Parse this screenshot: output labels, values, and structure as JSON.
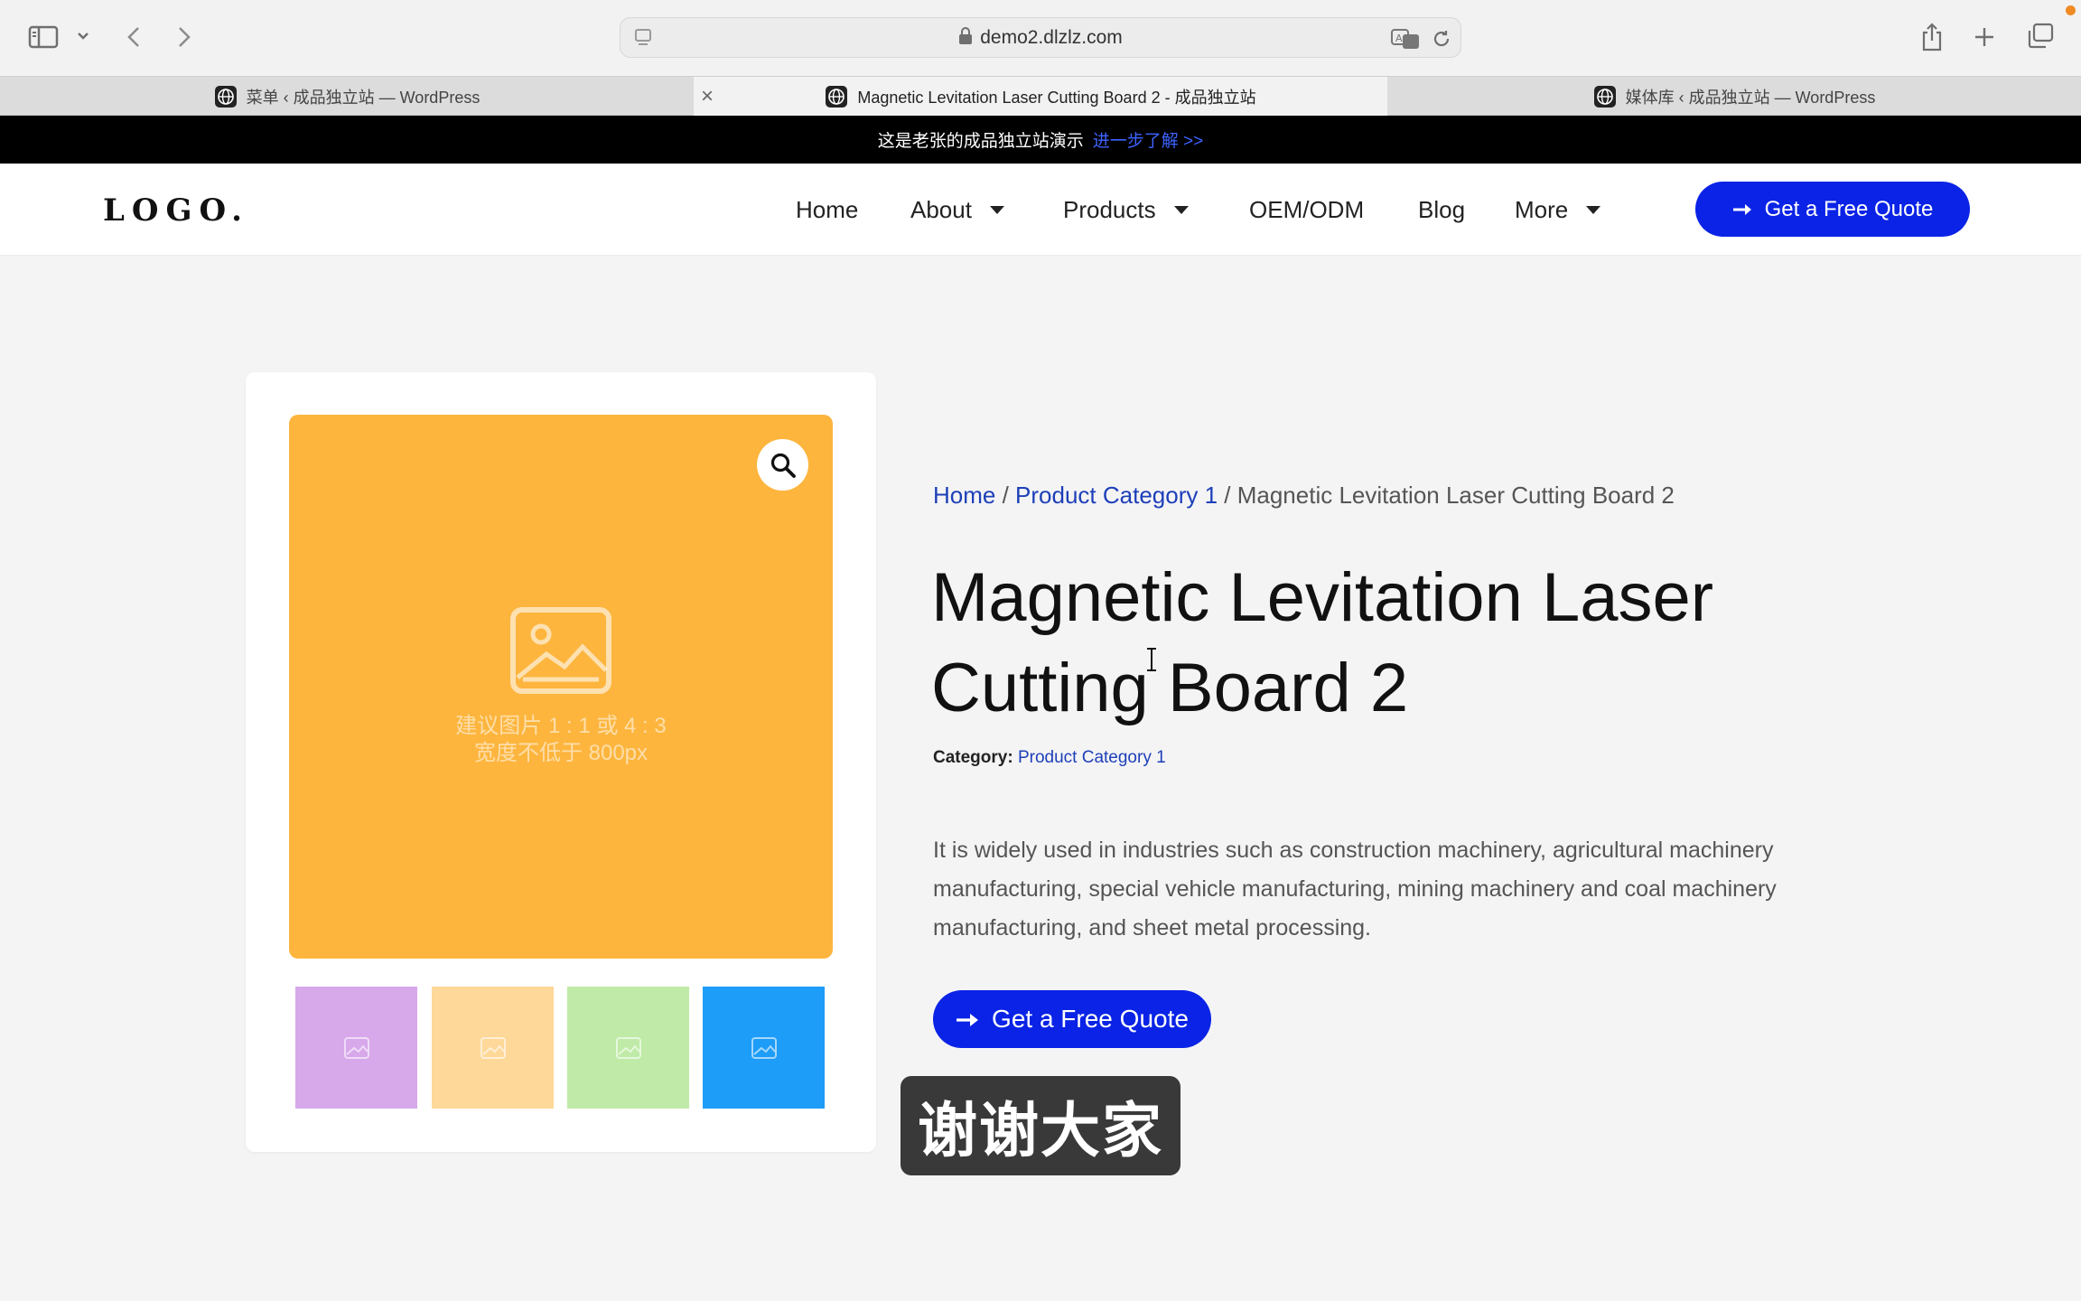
{
  "browser": {
    "url": "demo2.dlzlz.com",
    "tabs": [
      {
        "title": "菜单 ‹ 成品独立站 — WordPress",
        "active": false
      },
      {
        "title": "Magnetic Levitation Laser Cutting Board 2 - 成品独立站",
        "active": true
      },
      {
        "title": "媒体库 ‹ 成品独立站 — WordPress",
        "active": false
      }
    ],
    "tab_close": "×"
  },
  "announcement": {
    "text": "这是老张的成品独立站演示",
    "link": "进一步了解 >>"
  },
  "header": {
    "logo": "LOGO.",
    "nav": [
      {
        "label": "Home"
      },
      {
        "label": "About"
      },
      {
        "label": "Products"
      },
      {
        "label": "OEM/ODM"
      },
      {
        "label": "Blog"
      },
      {
        "label": "More"
      }
    ],
    "cta": "Get a Free Quote"
  },
  "product": {
    "image_caption_line1": "建议图片 1 : 1 或 4 : 3",
    "image_caption_line2": "宽度不低于 800px",
    "thumbnail_colors": [
      "#d7a8ea",
      "#fdd898",
      "#bfeaa7",
      "#1d9cf8"
    ],
    "breadcrumb": {
      "home": "Home",
      "sep": " / ",
      "category": "Product Category 1",
      "current": "Magnetic Levitation Laser Cutting Board 2"
    },
    "title": "Magnetic Levitation Laser Cutting Board 2",
    "category_label": "Category:",
    "category_value": "Product Category 1",
    "description": "It is widely used in industries such as construction machinery, agricultural machinery manufacturing, special vehicle manufacturing, mining machinery and coal machinery manufacturing, and sheet metal processing.",
    "cta": "Get a Free Quote"
  },
  "overlay_subtitle": "谢谢大家",
  "colors": {
    "accent_blue": "#0a23e6",
    "link_blue": "#1d3fb8",
    "image_orange": "#fdb53e"
  }
}
